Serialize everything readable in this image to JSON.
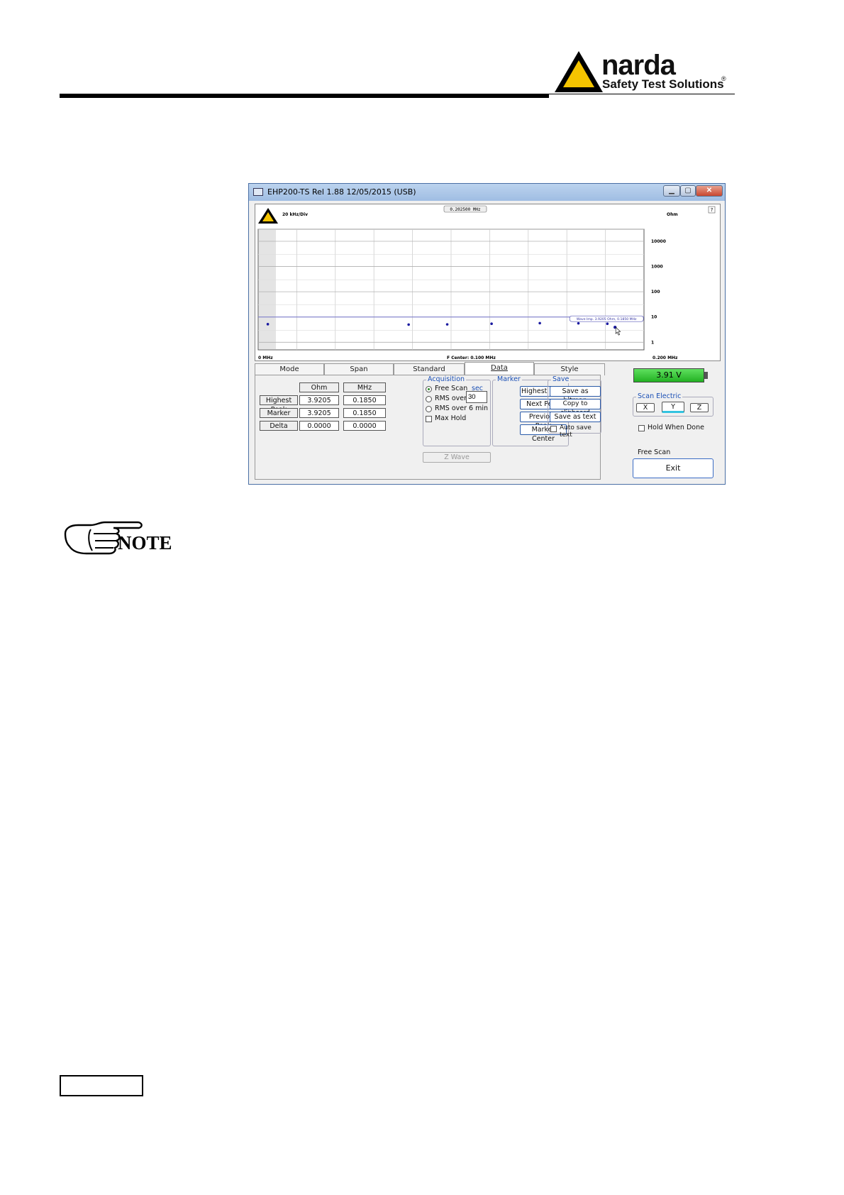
{
  "header": {
    "brand": "narda",
    "tagline": "Safety Test Solutions",
    "reg": "®"
  },
  "window": {
    "title": "EHP200-TS Rel 1.88 12/05/2015 (USB)",
    "close_label": "✕"
  },
  "chart": {
    "freq_readout": "0.202500 MHz",
    "div_label": "20 kHz/Div",
    "unit": "Ohm",
    "help": "?",
    "y_ticks": [
      "10000",
      "1000",
      "100",
      "10",
      "1"
    ],
    "x_start": "0 MHz",
    "x_center": "F Center: 0.100 MHz",
    "x_end": "0.200 MHz",
    "marker_label": "Wave Imp. 3.9205 Ohm, 0.1850 MHz"
  },
  "chart_data": {
    "type": "scatter",
    "x": [
      0.005,
      0.078,
      0.098,
      0.121,
      0.146,
      0.166,
      0.181
    ],
    "y": [
      5.2,
      5.0,
      5.1,
      5.4,
      5.7,
      5.6,
      5.4
    ],
    "xlim": [
      0,
      0.2
    ],
    "ylim": [
      0.5,
      30000
    ],
    "yscale": "log",
    "xlabel": "",
    "ylabel": "",
    "grid": true,
    "marker": {
      "x": 0.185,
      "y": 3.9205
    }
  },
  "tabs": [
    "Mode",
    "Span",
    "Standard",
    "Data",
    "Style"
  ],
  "active_tab": "Data",
  "data_table": {
    "headers": [
      "Ohm",
      "MHz"
    ],
    "rows": [
      {
        "label": "Highest Peak",
        "ohm": "3.9205",
        "mhz": "0.1850"
      },
      {
        "label": "Marker",
        "ohm": "3.9205",
        "mhz": "0.1850"
      },
      {
        "label": "Delta",
        "ohm": "0.0000",
        "mhz": "0.0000"
      }
    ]
  },
  "acquisition": {
    "title": "Acquisition",
    "free_scan": "Free Scan",
    "sec": "sec",
    "rms_over": "RMS over",
    "rms_value": "30",
    "rms_6min": "RMS over 6 min",
    "max_hold": "Max Hold"
  },
  "marker_group": {
    "title": "Marker",
    "buttons": [
      "Highest Peak",
      "Next Peak",
      "Previous Peak",
      "Marker Center"
    ]
  },
  "save_group": {
    "title": "Save",
    "buttons": [
      "Save as bitmap",
      "Copy to clipboard",
      "Save as text"
    ],
    "auto_save": "Auto save text"
  },
  "z_wave": "Z Wave",
  "battery": "3.91 V",
  "scan_electric": {
    "title": "Scan Electric",
    "axes": [
      "X",
      "Y",
      "Z"
    ]
  },
  "hold_when_done": "Hold When Done",
  "status": "Free Scan",
  "exit": "Exit",
  "note": "NOTE"
}
